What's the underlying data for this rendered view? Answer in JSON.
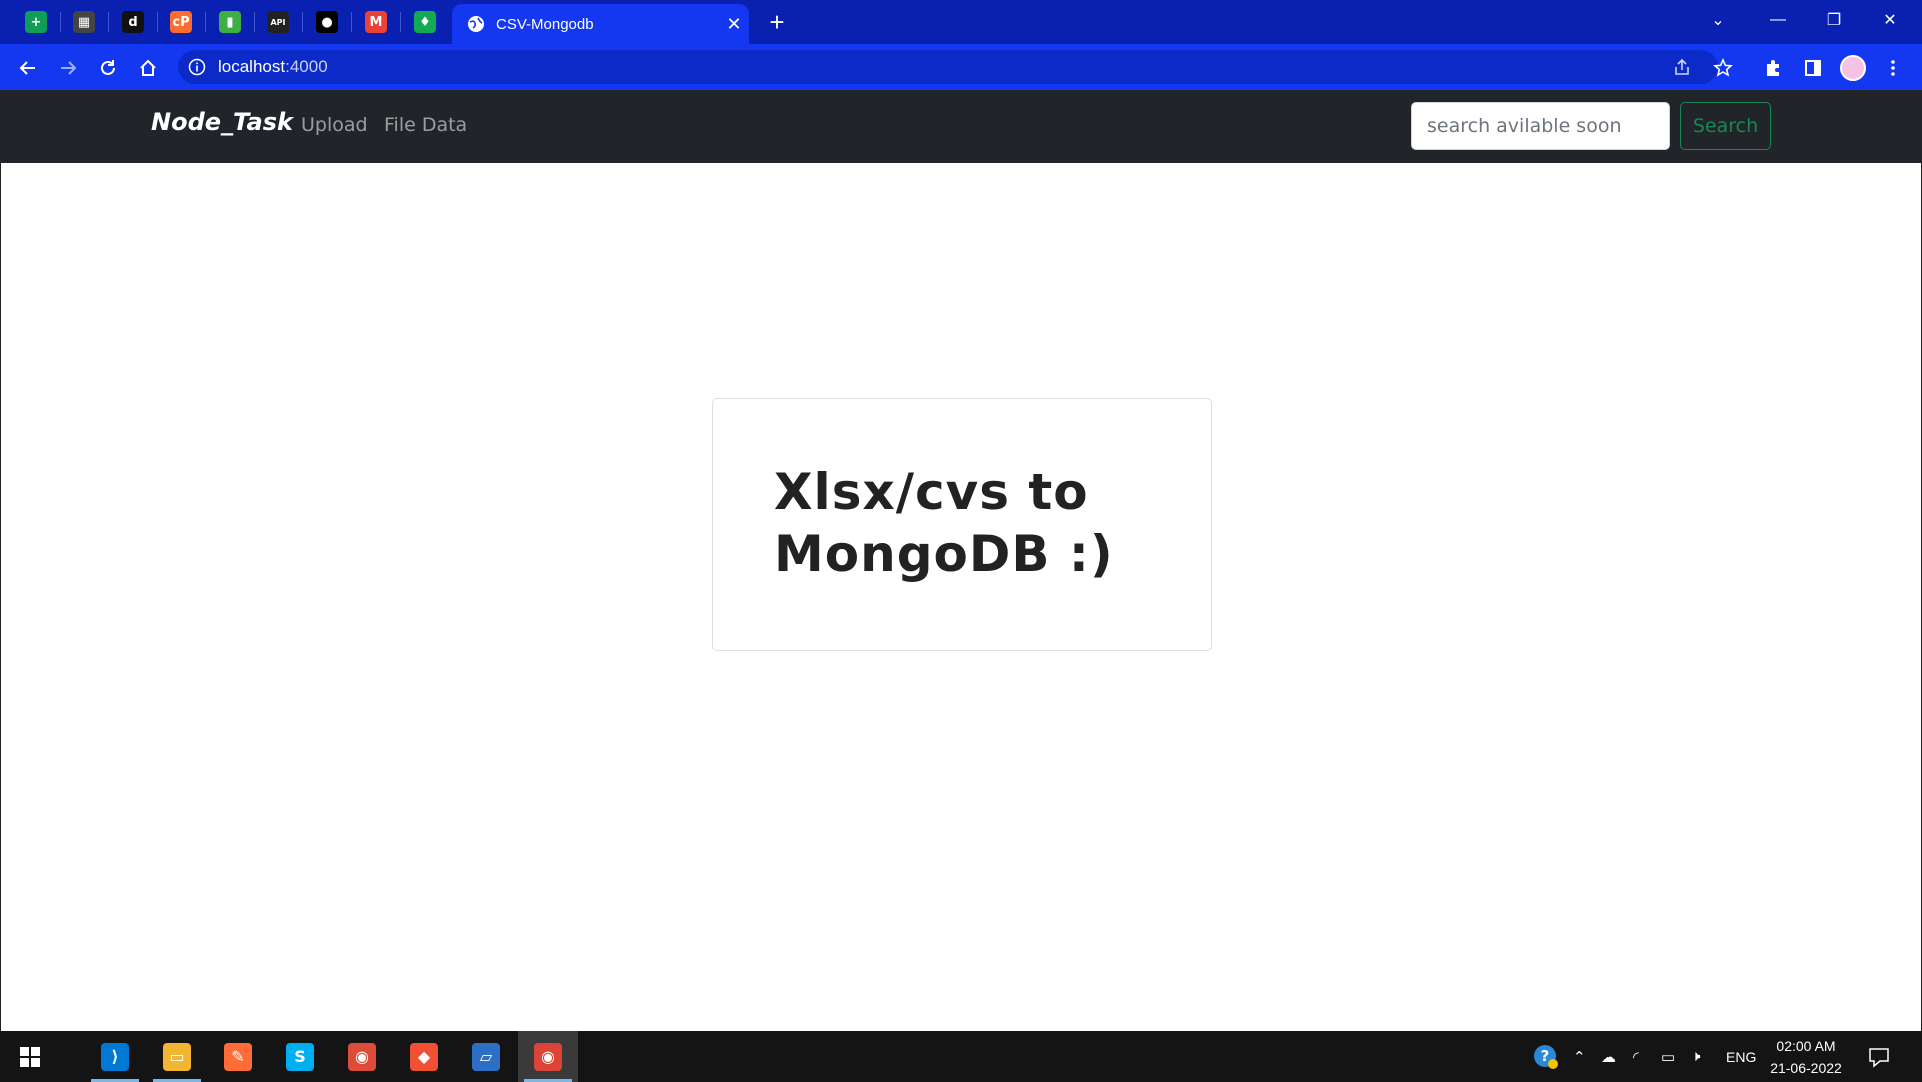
{
  "browser": {
    "pinned_tabs": [
      {
        "icon": "google-sheets-icon",
        "glyph": "+",
        "color": "#0f9d58"
      },
      {
        "icon": "qr-grid-icon",
        "glyph": "▦",
        "color": "#444444"
      },
      {
        "icon": "dark-app-icon",
        "glyph": "d",
        "color": "#111111"
      },
      {
        "icon": "cp-logo-icon",
        "glyph": "cP",
        "color": "#ff6c2c"
      },
      {
        "icon": "green-book-icon",
        "glyph": "▮",
        "color": "#3cb043"
      },
      {
        "icon": "mock-api-icon",
        "glyph": "API",
        "color": "#222222"
      },
      {
        "icon": "github-icon",
        "glyph": "●",
        "color": "#000000"
      },
      {
        "icon": "gmail-icon",
        "glyph": "M",
        "color": "#ea4335"
      },
      {
        "icon": "mongodb-leaf-icon",
        "glyph": "♦",
        "color": "#13aa52"
      }
    ],
    "active_tab_title": "CSV-Mongodb",
    "url_host": "localhost",
    "url_port": ":4000"
  },
  "navbar": {
    "brand": "Node_Task",
    "links": [
      "Upload",
      "File Data"
    ],
    "search_placeholder": "search avilable soon",
    "search_button": "Search"
  },
  "card": {
    "line1": "Xlsx/cvs to",
    "line2": "MongoDB :)"
  },
  "taskbar": {
    "apps": [
      {
        "icon": "vscode-icon",
        "glyph": "⟩",
        "color": "#0078d4",
        "running": true,
        "active": false
      },
      {
        "icon": "file-explorer-icon",
        "glyph": "▭",
        "color": "#f2b632",
        "running": true,
        "active": false
      },
      {
        "icon": "postman-icon",
        "glyph": "✎",
        "color": "#ff6c37",
        "running": false,
        "active": false
      },
      {
        "icon": "skype-icon",
        "glyph": "S",
        "color": "#00aff0",
        "running": false,
        "active": false
      },
      {
        "icon": "chrome-icon",
        "glyph": "◉",
        "color": "#dd4b39",
        "running": false,
        "active": false
      },
      {
        "icon": "git-icon",
        "glyph": "◆",
        "color": "#f05033",
        "running": false,
        "active": false
      },
      {
        "icon": "laptop-app-icon",
        "glyph": "▱",
        "color": "#2d6fc4",
        "running": false,
        "active": false
      },
      {
        "icon": "chrome-profile-icon",
        "glyph": "◉",
        "color": "#db4437",
        "running": true,
        "active": true
      }
    ],
    "language": "ENG",
    "time": "02:00 AM",
    "date": "21-06-2022"
  }
}
